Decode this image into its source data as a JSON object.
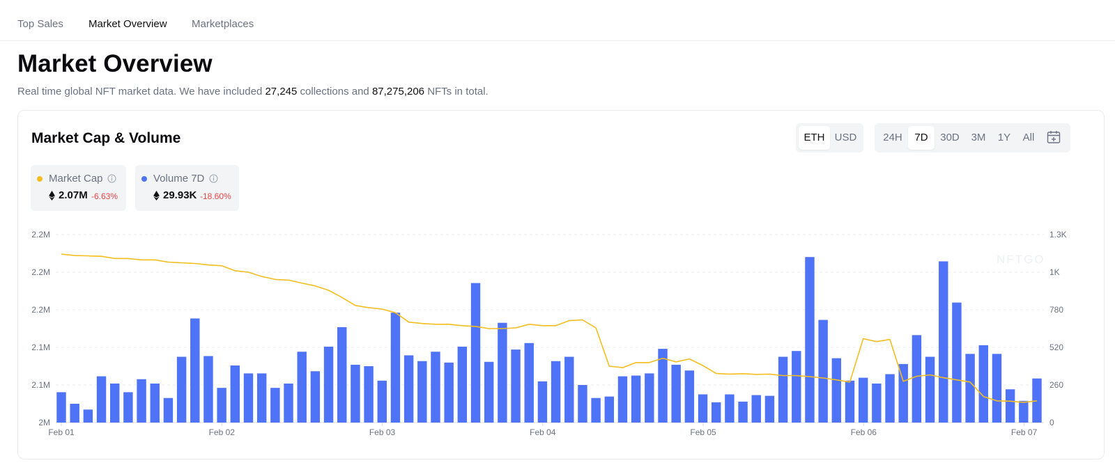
{
  "nav": {
    "tabs": [
      {
        "label": "Top Sales"
      },
      {
        "label": "Market Overview"
      },
      {
        "label": "Marketplaces"
      }
    ]
  },
  "header": {
    "title": "Market Overview",
    "subtitle_pre": "Real time global NFT market data. We have included",
    "collections": "27,245",
    "subtitle_mid": "collections and",
    "nfts": "87,275,206",
    "subtitle_post": "NFTs in total."
  },
  "card": {
    "title": "Market Cap & Volume",
    "currency": {
      "options": [
        "ETH",
        "USD"
      ],
      "selected": "ETH"
    },
    "range": {
      "options": [
        "24H",
        "7D",
        "30D",
        "3M",
        "1Y",
        "All"
      ],
      "selected": "7D"
    },
    "legend": [
      {
        "name": "Market Cap",
        "value": "2.07M",
        "change": "-6.63%",
        "color": "#f5bd1f"
      },
      {
        "name": "Volume 7D",
        "value": "29.93K",
        "change": "-18.60%",
        "color": "#4f73f6"
      }
    ],
    "watermark": "NFTGO"
  },
  "chart_data": {
    "type": "bar",
    "x_tick_labels": [
      "Feb 01",
      "Feb 02",
      "Feb 03",
      "Feb 04",
      "Feb 05",
      "Feb 06",
      "Feb 07"
    ],
    "y_left_tick_labels": [
      "2M",
      "2.1M",
      "2.1M",
      "2.2M",
      "2.2M",
      "2.2M"
    ],
    "y_right_tick_labels": [
      "0",
      "260",
      "520",
      "780",
      "1K",
      "1.3K"
    ],
    "y_right_range": [
      0,
      1300
    ],
    "grid": true,
    "series": [
      {
        "name": "Volume 7D",
        "type": "bar",
        "axis": "right",
        "color": "#4f73f6",
        "values": [
          210,
          130,
          90,
          320,
          270,
          210,
          300,
          270,
          170,
          455,
          720,
          460,
          240,
          395,
          340,
          340,
          240,
          270,
          490,
          355,
          525,
          660,
          400,
          390,
          290,
          760,
          465,
          425,
          490,
          415,
          525,
          965,
          420,
          690,
          505,
          550,
          285,
          425,
          455,
          260,
          170,
          180,
          320,
          325,
          340,
          510,
          400,
          360,
          195,
          140,
          195,
          145,
          190,
          185,
          455,
          495,
          1145,
          710,
          445,
          290,
          310,
          270,
          335,
          405,
          605,
          455,
          1115,
          830,
          475,
          535,
          475,
          230,
          150,
          305
        ]
      },
      {
        "name": "Market Cap",
        "type": "line",
        "axis": "left",
        "color": "#f5bd1f",
        "values": [
          1165,
          1155,
          1153,
          1150,
          1135,
          1135,
          1125,
          1125,
          1110,
          1105,
          1100,
          1090,
          1085,
          1050,
          1040,
          1010,
          990,
          985,
          965,
          945,
          915,
          865,
          810,
          795,
          785,
          760,
          695,
          685,
          680,
          680,
          670,
          665,
          650,
          650,
          655,
          680,
          670,
          670,
          705,
          710,
          655,
          390,
          380,
          415,
          415,
          445,
          420,
          440,
          395,
          340,
          335,
          338,
          333,
          335,
          325,
          325,
          318,
          308,
          295,
          280,
          580,
          560,
          575,
          285,
          320,
          330,
          310,
          295,
          280,
          180,
          150,
          148,
          140,
          150
        ]
      }
    ]
  }
}
